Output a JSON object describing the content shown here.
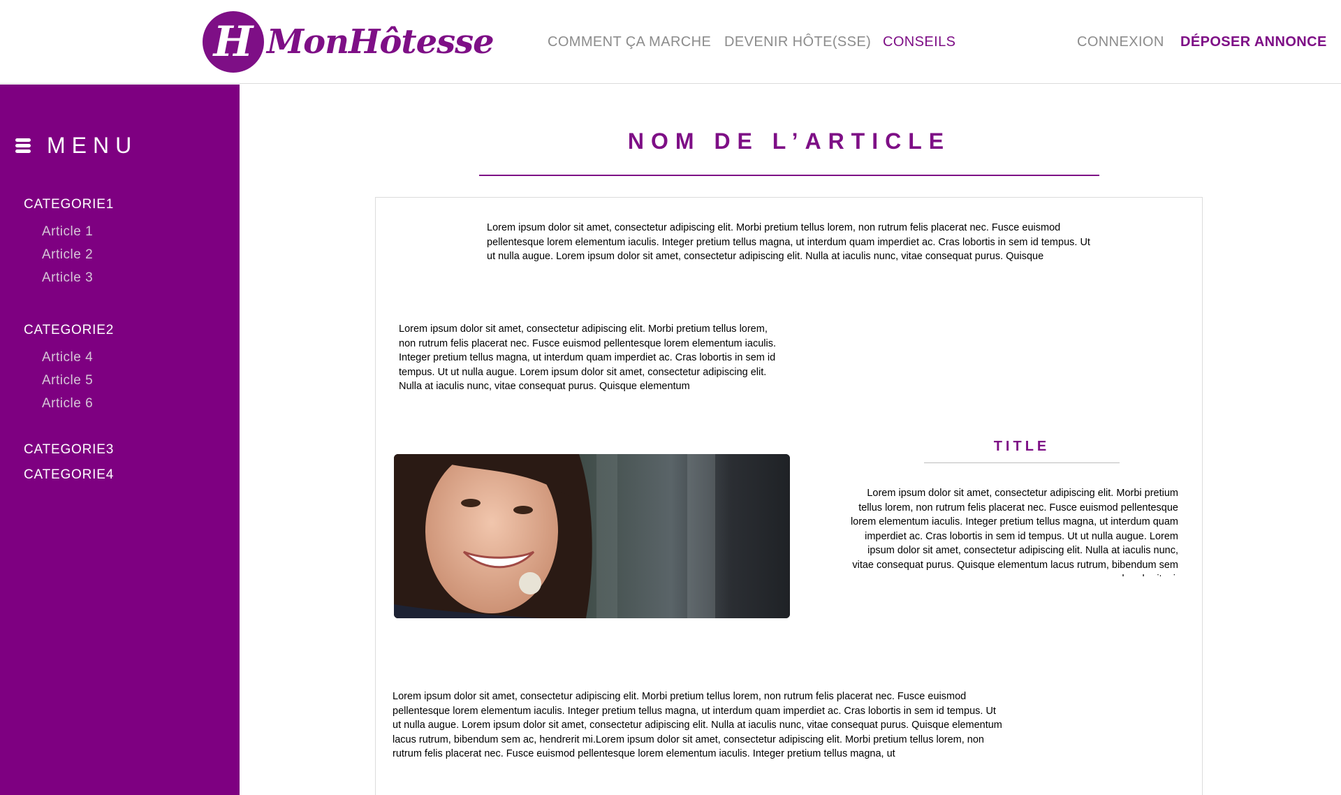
{
  "header": {
    "logo_letter": "H",
    "logo_text": "MonHôtesse",
    "nav": {
      "comment": "COMMENT ÇA MARCHE",
      "devenir": "DEVENIR HÔTE(SSE)",
      "conseils": "CONSEILS",
      "connexion": "CONNEXION",
      "deposer": "DÉPOSER ANNONCE"
    }
  },
  "sidebar": {
    "menu_label": "MENU",
    "categories": [
      {
        "label": "CATEGORIE1",
        "articles": [
          "Article 1",
          "Article 2",
          "Article 3"
        ]
      },
      {
        "label": "CATEGORIE2",
        "articles": [
          "Article 4",
          "Article 5",
          "Article 6"
        ]
      },
      {
        "label": "CATEGORIE3",
        "articles": []
      },
      {
        "label": "CATEGORIE4",
        "articles": []
      }
    ]
  },
  "main": {
    "title": "NOM DE L’ARTICLE",
    "intro": "Lorem ipsum dolor sit amet, consectetur adipiscing elit. Morbi pretium tellus lorem, non rutrum felis placerat nec. Fusce euismod pellentesque lorem elementum iaculis. Integer pretium tellus magna, ut interdum quam imperdiet ac. Cras lobortis in sem id tempus. Ut ut nulla augue. Lorem ipsum dolor sit amet, consectetur adipiscing elit. Nulla at iaculis nunc, vitae consequat purus. Quisque",
    "left_paragraph": "Lorem ipsum dolor sit amet, consectetur adipiscing elit. Morbi pretium tellus lorem, non rutrum felis placerat nec. Fusce euismod pellentesque lorem elementum iaculis. Integer pretium tellus magna, ut interdum quam imperdiet ac. Cras lobortis in sem id tempus. Ut ut nulla augue. Lorem ipsum dolor sit amet, consectetur adipiscing elit. Nulla at iaculis nunc, vitae consequat purus. Quisque elementum",
    "section_title": "TITLE",
    "side_paragraph": "Lorem ipsum dolor sit amet, consectetur adipiscing elit. Morbi pretium tellus lorem, non rutrum felis placerat nec. Fusce euismod pellentesque lorem elementum iaculis. Integer pretium tellus magna, ut interdum quam imperdiet ac. Cras lobortis in sem id tempus. Ut ut nulla augue. Lorem ipsum dolor sit amet, consectetur adipiscing elit. Nulla at iaculis nunc, vitae consequat purus. Quisque elementum lacus rutrum, bibendum sem ac, hendrerit mi.",
    "bottom_paragraph": "Lorem ipsum dolor sit amet, consectetur adipiscing elit. Morbi pretium tellus lorem, non rutrum felis placerat nec. Fusce euismod pellentesque lorem elementum iaculis. Integer pretium tellus magna, ut interdum quam imperdiet ac. Cras lobortis in sem id tempus. Ut ut nulla augue. Lorem ipsum dolor sit amet, consectetur adipiscing elit. Nulla at iaculis nunc, vitae consequat purus. Quisque elementum lacus rutrum, bibendum sem ac, hendrerit mi.Lorem ipsum dolor sit amet, consectetur adipiscing elit. Morbi pretium tellus lorem, non rutrum felis placerat nec. Fusce euismod pellentesque lorem elementum iaculis. Integer pretium tellus magna, ut"
  },
  "colors": {
    "brand": "#7e0f86",
    "sidebar": "#7e0081",
    "nav_text": "#8c8c8c"
  }
}
